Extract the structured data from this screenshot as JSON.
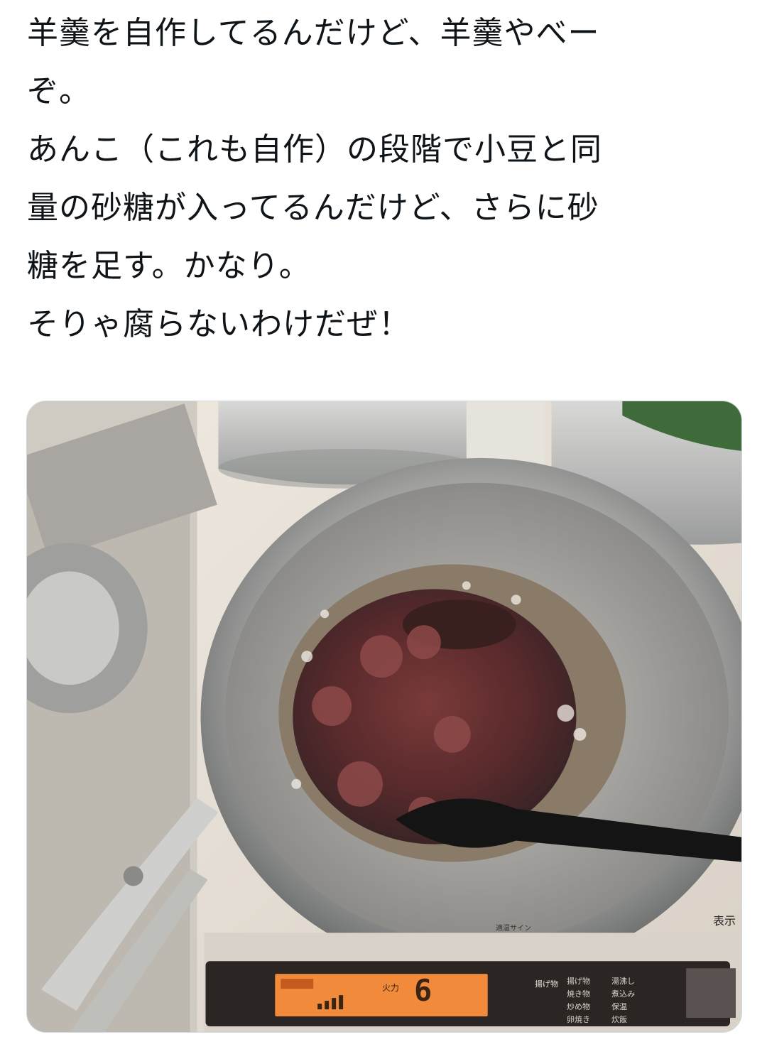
{
  "post": {
    "lines": [
      "羊羹を自作してるんだけど、羊羹やべー",
      "ぞ。",
      "あんこ（これも自作）の段階で小豆と同",
      "量の砂糖が入ってるんだけど、さらに砂",
      "糖を足す。かなり。",
      "そりゃ腐らないわけだぜ！"
    ]
  },
  "media": {
    "stove_labels": {
      "sign": "適温サイン",
      "display": "表示",
      "power_label": "火力",
      "power_value": "6",
      "mode": "揚げ物",
      "modes": [
        "揚げ物",
        "焼き物",
        "炒め物",
        "卵焼き",
        "湯沸し",
        "煮込み",
        "保温",
        "炊飯"
      ]
    }
  },
  "colors": {
    "text": "#0f1419",
    "card_border": "#cfd9de",
    "lcd_orange": "#f28a3b"
  }
}
